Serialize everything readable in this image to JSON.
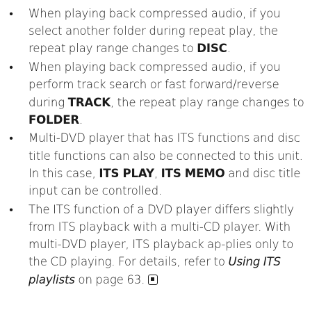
{
  "bullets": [
    {
      "t1": "When playing back compressed audio, if you select another folder during repeat play, the repeat play range changes to ",
      "b1": "DISC",
      "t2": "."
    },
    {
      "t1": "When playing back compressed audio, if you perform track search or fast forward/reverse during ",
      "b1": "TRACK",
      "t2": ", the repeat play range changes to ",
      "b2": "FOLDER",
      "t3": "."
    },
    {
      "t1": "Multi-DVD player that has ITS functions and disc title functions can also be connected to this unit. In this case, ",
      "b1": "ITS PLAY",
      "t2": ", ",
      "b2": "ITS MEMO",
      "t3": " and disc title input can be controlled."
    },
    {
      "t1": "The ITS function of a DVD player differs slightly from ITS playback with a multi-CD player. With multi-DVD player, ITS playback ap-plies only to the CD playing. For details, refer to ",
      "i1": "Using ITS playlists",
      "t2": " on page 63."
    }
  ],
  "bullet_glyph": "•",
  "end_mark_icon": "end-of-section-square-icon"
}
